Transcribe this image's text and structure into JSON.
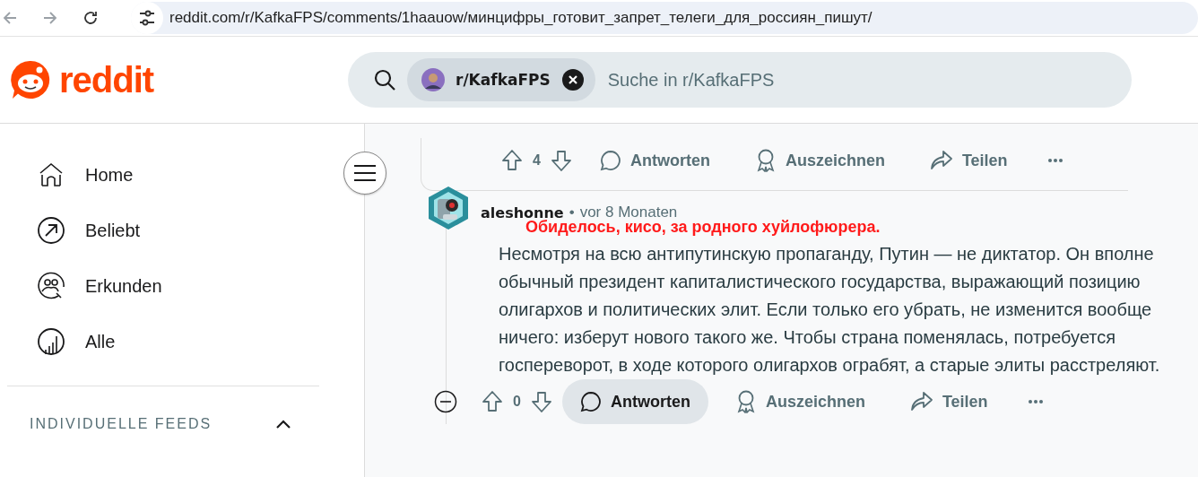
{
  "browser": {
    "url": "reddit.com/r/KafkaFPS/comments/1haauow/минцифры_готовит_запрет_телеги_для_россиян_пишут/"
  },
  "header": {
    "logo_text": "reddit",
    "search": {
      "chip": "r/KafkaFPS",
      "placeholder": "Suche in r/KafkaFPS"
    }
  },
  "sidebar": {
    "items": [
      {
        "kind": "home",
        "label": "Home",
        "selected": false
      },
      {
        "kind": "popular",
        "label": "Beliebt",
        "selected": false
      },
      {
        "kind": "explore",
        "label": "Erkunden",
        "selected": false
      },
      {
        "kind": "all",
        "label": "Alle",
        "selected": false
      }
    ],
    "section": {
      "title": "INDIVIDUELLE FEEDS",
      "expanded": true
    }
  },
  "comments": [
    {
      "collapse_button": false,
      "votes": "4",
      "actions": [
        {
          "kind": "reply",
          "label": "Antworten",
          "highlighted": false
        },
        {
          "kind": "award",
          "label": "Auszeichnen",
          "highlighted": false
        },
        {
          "kind": "share",
          "label": "Teilen",
          "highlighted": false
        }
      ]
    },
    {
      "author": "aleshonne",
      "separator": "•",
      "time": "vor 8 Monaten",
      "flair": "Обиделось, кисо, за родного хуйлофюрера.",
      "body": "Несмотря на всю антипутинскую пропаганду, Путин — не диктатор. Он вполне обычный президент капиталистического государства, выражающий позицию олигархов и политических элит. Если только его убрать, не изменится вообще ничего: изберут нового такого же. Чтобы страна поменялась, потребуется госпереворот, в ходе которого олигархов ограбят, а старые элиты расстреляют.",
      "collapse_button": true,
      "votes": "0",
      "actions": [
        {
          "kind": "reply",
          "label": "Antworten",
          "highlighted": true
        },
        {
          "kind": "award",
          "label": "Auszeichnen",
          "highlighted": false
        },
        {
          "kind": "share",
          "label": "Teilen",
          "highlighted": false
        }
      ]
    }
  ]
}
